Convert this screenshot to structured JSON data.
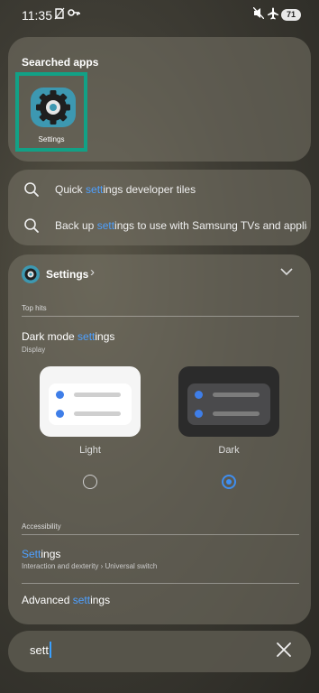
{
  "status_bar": {
    "time": "11:35",
    "battery": "71"
  },
  "searched_apps": {
    "title": "Searched apps",
    "apps": [
      {
        "label": "Settings"
      }
    ]
  },
  "suggestions": [
    {
      "pre": "Quick ",
      "match": "sett",
      "post": "ings developer tiles"
    },
    {
      "pre": "Back up ",
      "match": "sett",
      "post": "ings to use with Samsung TVs and applia..."
    }
  ],
  "settings_section": {
    "app_name": "Settings",
    "top_hits_label": "Top hits",
    "dark_mode": {
      "pre": "Dark mode ",
      "match": "sett",
      "post": "ings",
      "subtitle": "Display"
    },
    "themes": [
      {
        "label": "Light",
        "selected": false
      },
      {
        "label": "Dark",
        "selected": true
      }
    ],
    "accessibility_label": "Accessibility",
    "accessibility_item": {
      "match": "Sett",
      "post": "ings",
      "subtitle": "Interaction and dexterity › Universal switch"
    },
    "advanced": {
      "pre": "Advanced ",
      "match": "sett",
      "post": "ings"
    }
  },
  "search": {
    "query": "sett"
  },
  "colors": {
    "accent": "#4ea0ff",
    "highlight_border": "#12a186",
    "app_icon": "#3d98b1"
  }
}
